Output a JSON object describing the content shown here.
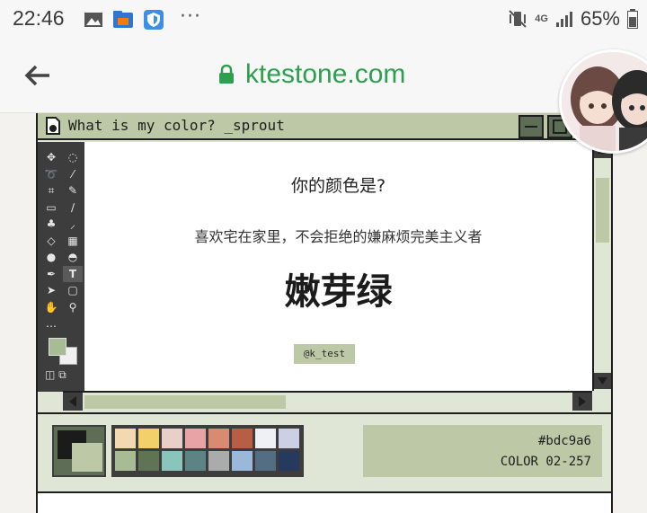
{
  "status_bar": {
    "time": "22:46",
    "dots": "···",
    "network": "4G",
    "battery": "65%"
  },
  "browser": {
    "url": "ktestone.com"
  },
  "window": {
    "title": "What is my color? _sprout"
  },
  "content": {
    "question": "你的颜色是?",
    "description": "喜欢宅在家里，不会拒绝的嫌麻烦完美主义者",
    "color_name": "嫩芽绿",
    "tag": "@k_test"
  },
  "panel": {
    "palette": [
      "#f2d9b0",
      "#f3d06a",
      "#e8cfc8",
      "#e8a3a6",
      "#d98b72",
      "#b85e45",
      "#eef0f5",
      "#ccd0e4",
      "#a7bb95",
      "#5e7454",
      "#8ac5bb",
      "#5e8384",
      "#a9acab",
      "#9ab8d9",
      "#536e82",
      "#253a5e"
    ],
    "hex": "#bdc9a6",
    "color_code": "COLOR 02-257"
  },
  "colors": {
    "accent": "#bdc9a6",
    "dark": "#1e1e1e",
    "url_green": "#2e9e4f"
  }
}
